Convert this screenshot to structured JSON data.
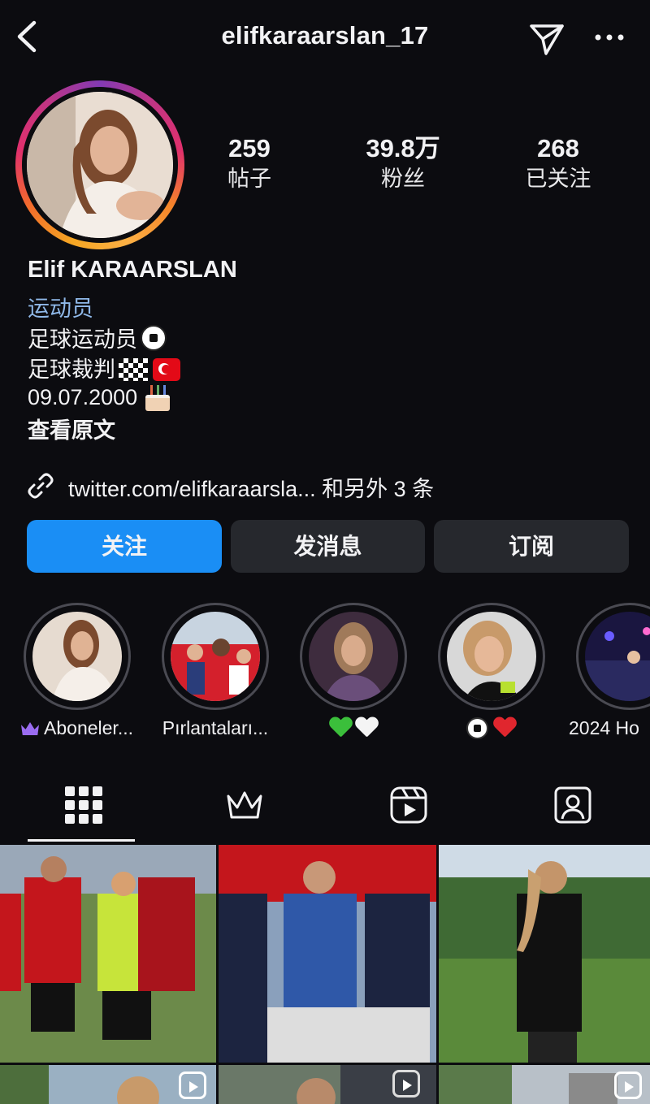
{
  "header": {
    "username": "elifkaraarslan_17"
  },
  "stats": [
    {
      "value": "259",
      "label": "帖子"
    },
    {
      "value": "39.8万",
      "label": "粉丝"
    },
    {
      "value": "268",
      "label": "已关注"
    }
  ],
  "bio": {
    "full_name": "Elif KARAARSLAN",
    "category": "运动员",
    "line1": "足球运动员",
    "line2": "足球裁判",
    "line3": " 09.07.2000",
    "see_more": "查看原文"
  },
  "link": {
    "text": "twitter.com/elifkaraarsla... 和另外 3 条"
  },
  "buttons": {
    "follow": "关注",
    "message": "发消息",
    "subscribe": "订阅"
  },
  "highlights": [
    {
      "label": "Aboneler...",
      "icon": "crown-icon"
    },
    {
      "label": "Pırlantaları..."
    },
    {
      "label": "",
      "icons": [
        "green-heart",
        "white-heart"
      ]
    },
    {
      "label": "",
      "icons": [
        "soccer-ball",
        "red-heart"
      ]
    },
    {
      "label": "2024 Ho"
    }
  ],
  "tabs": [
    {
      "name": "grid-icon",
      "active": true
    },
    {
      "name": "crown-icon"
    },
    {
      "name": "reels-icon"
    },
    {
      "name": "tagged-icon"
    }
  ],
  "colors": {
    "background": "#0c0c10",
    "follow_button": "#1a8ef5",
    "secondary_button": "#26282d",
    "category_text": "#8fb8e8"
  }
}
